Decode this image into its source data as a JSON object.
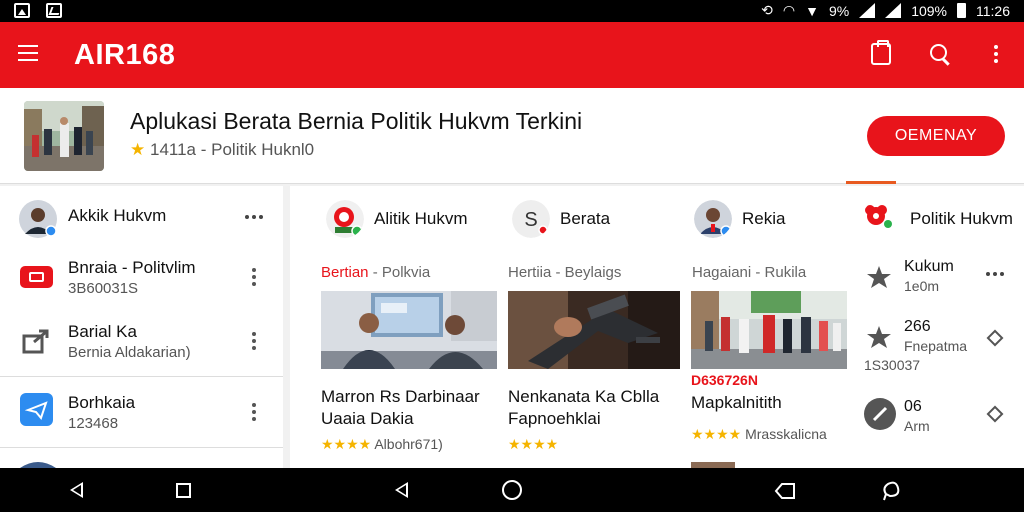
{
  "status_bar": {
    "signal_text": "9%",
    "battery": "109%",
    "time": "11:26"
  },
  "app_bar": {
    "title": "AIR168"
  },
  "app_header": {
    "name": "Aplukasi Berata Bernia Politik Hukvm Terkini",
    "rating": "1411a",
    "category": "Politik Huknl0",
    "separator": "-",
    "install_label": "OEMENAY"
  },
  "left_panel": {
    "header": {
      "label": "Akkik Hukvm"
    },
    "items": [
      {
        "title": "Bnraia - Politvlim",
        "subtitle": "3B60031S"
      },
      {
        "title": "Barial Ka",
        "subtitle": "Bernia Aldakarian)"
      },
      {
        "title": "Borhkaia",
        "subtitle": "123468"
      }
    ]
  },
  "main_panel": {
    "columns": [
      {
        "label": "Alitik Hukvm",
        "category_red": "Bertian",
        "category_rest": " - Polkvia",
        "title_line1": "Marron Rs Darbinaar",
        "title_line2": "Uaaia Dakia",
        "rating_text": "Albohr671)"
      },
      {
        "label": "Berata",
        "category_red": "",
        "category_rest": "Hertiia - Beylaigs",
        "title_line1": "Nenkanata Ka Cblla",
        "title_line2": "Fapnoehklai",
        "rating_text": ""
      },
      {
        "label": "Rekia",
        "category_red": "",
        "category_rest": "Hagaiani - Rukila",
        "tag": "D636726N",
        "title_line1": "Mapkalnitith",
        "title_line2": "",
        "rating_text": "Mrasskalicna"
      }
    ],
    "right_column": {
      "label": "Politik Hukvm",
      "rows": [
        {
          "title": "Kukum",
          "subtitle": "1e0m"
        },
        {
          "title": "266",
          "subtitle": "Fnepatma",
          "extra": "1S30037"
        },
        {
          "title": "06",
          "subtitle": "Arm"
        }
      ]
    }
  },
  "colors": {
    "accent": "#e8141b",
    "star": "#f5b400"
  }
}
